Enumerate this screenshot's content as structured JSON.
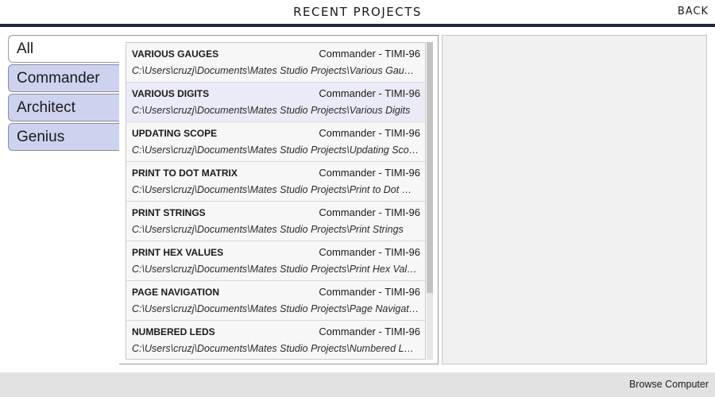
{
  "header": {
    "title": "RECENT PROJECTS",
    "back_label": "BACK"
  },
  "tabs": [
    {
      "label": "All",
      "active": true
    },
    {
      "label": "Commander",
      "active": false
    },
    {
      "label": "Architect",
      "active": false
    },
    {
      "label": "Genius",
      "active": false
    }
  ],
  "projects": [
    {
      "name": "VARIOUS GAUGES",
      "device": "Commander - TIMI-96",
      "path": "C:\\Users\\cruzj\\Documents\\Mates Studio Projects\\Various Gauges",
      "selected": false
    },
    {
      "name": "VARIOUS DIGITS",
      "device": "Commander - TIMI-96",
      "path": "C:\\Users\\cruzj\\Documents\\Mates Studio Projects\\Various Digits",
      "selected": true
    },
    {
      "name": "UPDATING SCOPE",
      "device": "Commander - TIMI-96",
      "path": "C:\\Users\\cruzj\\Documents\\Mates Studio Projects\\Updating Scope",
      "selected": false
    },
    {
      "name": "PRINT TO DOT MATRIX",
      "device": "Commander - TIMI-96",
      "path": "C:\\Users\\cruzj\\Documents\\Mates Studio Projects\\Print to Dot Matrix",
      "selected": false
    },
    {
      "name": "PRINT STRINGS",
      "device": "Commander - TIMI-96",
      "path": "C:\\Users\\cruzj\\Documents\\Mates Studio Projects\\Print Strings",
      "selected": false
    },
    {
      "name": "PRINT HEX VALUES",
      "device": "Commander - TIMI-96",
      "path": "C:\\Users\\cruzj\\Documents\\Mates Studio Projects\\Print Hex Values",
      "selected": false
    },
    {
      "name": "PAGE NAVIGATION",
      "device": "Commander - TIMI-96",
      "path": "C:\\Users\\cruzj\\Documents\\Mates Studio Projects\\Page Navigation",
      "selected": false
    },
    {
      "name": "NUMBERED LEDS",
      "device": "Commander - TIMI-96",
      "path": "C:\\Users\\cruzj\\Documents\\Mates Studio Projects\\Numbered LEDs",
      "selected": false
    }
  ],
  "footer": {
    "browse_label": "Browse Computer"
  }
}
